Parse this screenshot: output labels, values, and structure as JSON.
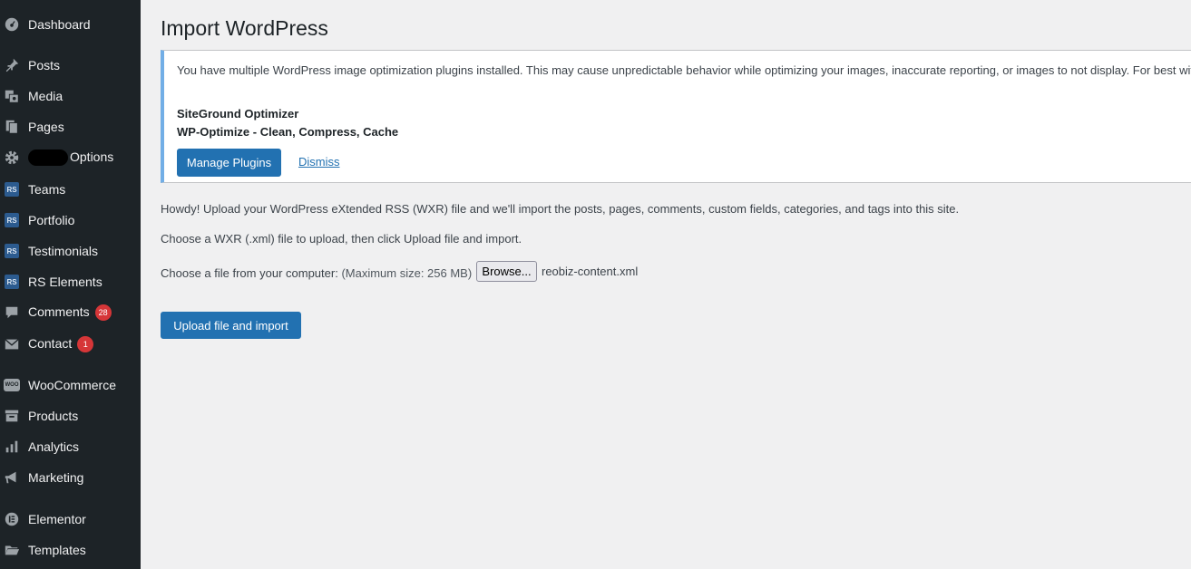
{
  "sidebar": {
    "items": [
      {
        "label": "Dashboard",
        "icon": "dashboard-icon"
      },
      {
        "label": "Posts",
        "icon": "pin-icon"
      },
      {
        "label": "Media",
        "icon": "media-icon"
      },
      {
        "label": "Pages",
        "icon": "pages-icon"
      },
      {
        "label": "Options",
        "icon": "gear-icon"
      },
      {
        "label": "Teams",
        "icon": "rs-icon"
      },
      {
        "label": "Portfolio",
        "icon": "rs-icon"
      },
      {
        "label": "Testimonials",
        "icon": "rs-icon"
      },
      {
        "label": "RS Elements",
        "icon": "rs-icon"
      },
      {
        "label": "Comments",
        "icon": "comment-icon",
        "badge": "28"
      },
      {
        "label": "Contact",
        "icon": "mail-icon",
        "badge": "1"
      },
      {
        "label": "WooCommerce",
        "icon": "woo-icon"
      },
      {
        "label": "Products",
        "icon": "archive-icon"
      },
      {
        "label": "Analytics",
        "icon": "bar-chart-icon"
      },
      {
        "label": "Marketing",
        "icon": "megaphone-icon"
      },
      {
        "label": "Elementor",
        "icon": "elementor-icon"
      },
      {
        "label": "Templates",
        "icon": "folder-icon"
      }
    ],
    "rs_icon_text": "RS",
    "woo_icon_text": "WOO"
  },
  "main": {
    "title": "Import WordPress",
    "notice": {
      "message": "You have multiple WordPress image optimization plugins installed. This may cause unpredictable behavior while optimizing your images, inaccurate reporting, or images to not display. For best with Smush:",
      "plugins": [
        "SiteGround Optimizer",
        "WP-Optimize - Clean, Compress, Cache"
      ],
      "manage_button": "Manage Plugins",
      "dismiss_link": "Dismiss"
    },
    "intro": "Howdy! Upload your WordPress eXtended RSS (WXR) file and we'll import the posts, pages, comments, custom fields, categories, and tags into this site.",
    "instruction": "Choose a WXR (.xml) file to upload, then click Upload file and import.",
    "file_label": "Choose a file from your computer:",
    "max_size": "(Maximum size: 256 MB)",
    "browse_button": "Browse...",
    "selected_file": "reobiz-content.xml",
    "submit_button": "Upload file and import"
  },
  "colors": {
    "sidebar_bg": "#1d2327",
    "accent": "#2271b1",
    "notice_border": "#72aee6",
    "badge": "#d63638"
  }
}
